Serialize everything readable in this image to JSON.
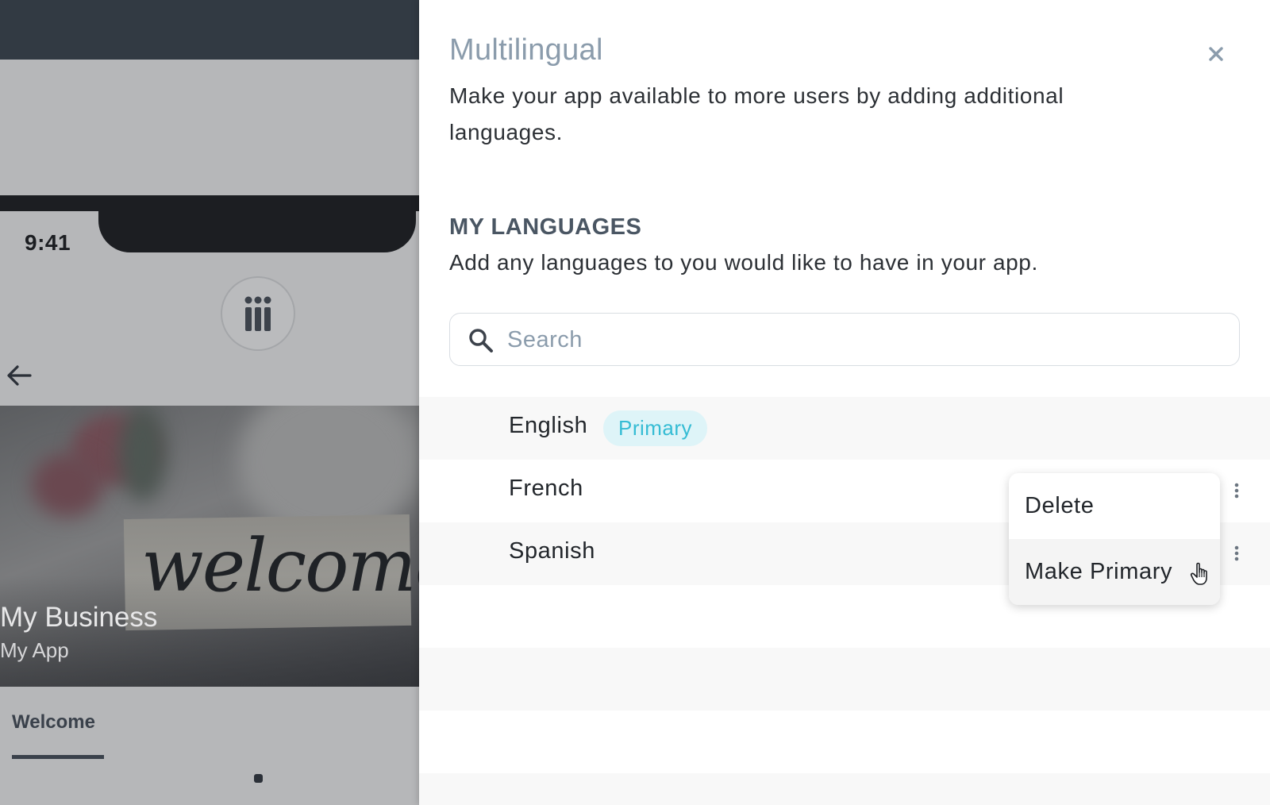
{
  "preview": {
    "status_time": "9:41",
    "hero_title": "My Business",
    "hero_subtitle": "My App",
    "hero_script_text": "welcome",
    "tab_label": "Welcome"
  },
  "drawer": {
    "title": "Multilingual",
    "description": "Make your app available to more users by adding additional languages.",
    "section_heading": "MY LANGUAGES",
    "section_description": "Add any languages to you would like to have in your app.",
    "search": {
      "placeholder": "Search",
      "value": ""
    },
    "languages": [
      {
        "name": "English",
        "badge": "Primary"
      },
      {
        "name": "French"
      },
      {
        "name": "Spanish"
      }
    ],
    "context_menu": {
      "items": [
        "Delete",
        "Make Primary"
      ]
    }
  },
  "colors": {
    "accent_badge_text": "#35bcd4",
    "accent_badge_bg": "#def4f8",
    "title_muted": "#8b9cac",
    "overlay_dark": "#323a43"
  },
  "icons": [
    "app-logo-icon",
    "back-arrow-icon",
    "close-icon",
    "search-icon",
    "kebab-menu-icon",
    "hand-cursor-icon"
  ]
}
